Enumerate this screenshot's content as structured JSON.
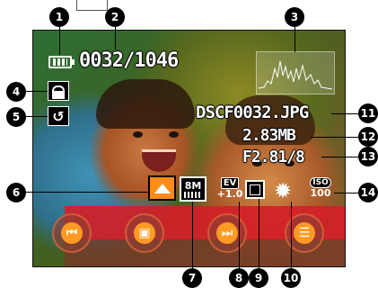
{
  "counter": "0032/1046",
  "file": {
    "name": "DSCF0032.JPG",
    "size": "2.83MB",
    "exposure": "F2.81/8"
  },
  "indicators": {
    "resolution": "8M",
    "ev_label": "EV",
    "ev_value": "+1.0",
    "iso_label": "ISO",
    "iso_value": "100"
  },
  "callouts": [
    "1",
    "2",
    "3",
    "4",
    "5",
    "6",
    "7",
    "8",
    "9",
    "10",
    "11",
    "12",
    "13",
    "14"
  ],
  "icons": {
    "battery": "battery-icon",
    "lock": "lock-icon",
    "slideshow": "return-icon",
    "scene": "scene-icon",
    "white_balance": "sun-icon",
    "focus": "focus-frame-icon",
    "histogram": "histogram-icon"
  },
  "colors": {
    "accent_orange": "#ff9a23",
    "status_red": "#d22028"
  }
}
